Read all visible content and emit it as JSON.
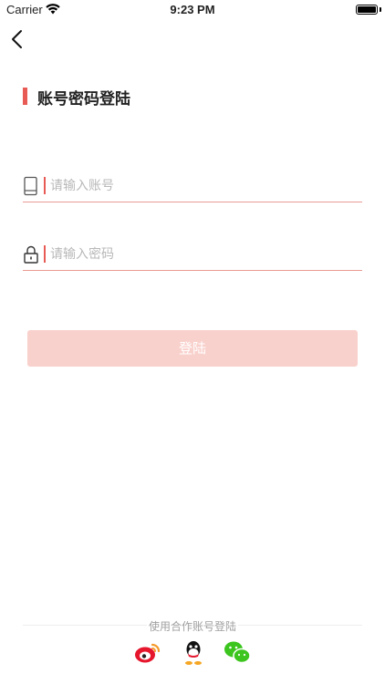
{
  "status_bar": {
    "carrier": "Carrier",
    "time": "9:23 PM"
  },
  "nav": {
    "back_icon": "chevron-left-icon"
  },
  "page": {
    "title": "账号密码登陆",
    "accent_color": "#e85b55"
  },
  "form": {
    "account": {
      "icon": "phone-icon",
      "placeholder": "请输入账号",
      "value": ""
    },
    "password": {
      "icon": "lock-icon",
      "placeholder": "请输入密码",
      "value": ""
    },
    "login_label": "登陆",
    "login_button_color": "#f9d1cc"
  },
  "partner": {
    "title": "使用合作账号登陆",
    "providers": [
      {
        "name": "weibo",
        "icon": "weibo-icon"
      },
      {
        "name": "qq",
        "icon": "qq-icon"
      },
      {
        "name": "wechat",
        "icon": "wechat-icon"
      }
    ]
  }
}
